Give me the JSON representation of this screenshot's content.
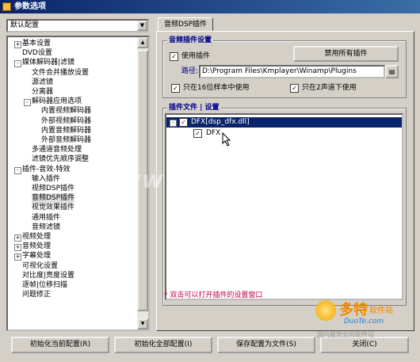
{
  "window": {
    "title": "参数选项"
  },
  "profile_combo": {
    "value": "默认配置"
  },
  "tree": [
    {
      "label": "基本设置",
      "level": 0,
      "exp": "+"
    },
    {
      "label": "DVD设置",
      "level": 0,
      "exp": ""
    },
    {
      "label": "媒体解码器|滤镜",
      "level": 0,
      "exp": "-"
    },
    {
      "label": "文件合并播放设置",
      "level": 1,
      "exp": ""
    },
    {
      "label": "源滤镜",
      "level": 1,
      "exp": ""
    },
    {
      "label": "分离器",
      "level": 1,
      "exp": ""
    },
    {
      "label": "解码器应用选项",
      "level": 1,
      "exp": "-"
    },
    {
      "label": "内置视频解码器",
      "level": 2,
      "exp": ""
    },
    {
      "label": "外部视频解码器",
      "level": 2,
      "exp": ""
    },
    {
      "label": "内置音频解码器",
      "level": 2,
      "exp": ""
    },
    {
      "label": "外部音频解码器",
      "level": 2,
      "exp": ""
    },
    {
      "label": "多通道音频处理",
      "level": 1,
      "exp": ""
    },
    {
      "label": "滤镜优先顺序调整",
      "level": 1,
      "exp": ""
    },
    {
      "label": "插件-音效-特效",
      "level": 0,
      "exp": "-"
    },
    {
      "label": "输入插件",
      "level": 1,
      "exp": ""
    },
    {
      "label": "视频DSP插件",
      "level": 1,
      "exp": ""
    },
    {
      "label": "音频DSP插件",
      "level": 1,
      "exp": "",
      "selected": true
    },
    {
      "label": "视觉效果插件",
      "level": 1,
      "exp": ""
    },
    {
      "label": "通用插件",
      "level": 1,
      "exp": ""
    },
    {
      "label": "音频滤镜",
      "level": 1,
      "exp": ""
    },
    {
      "label": "视频处理",
      "level": 0,
      "exp": "+"
    },
    {
      "label": "音频处理",
      "level": 0,
      "exp": "+"
    },
    {
      "label": "字幕处理",
      "level": 0,
      "exp": "+"
    },
    {
      "label": "可视化设置",
      "level": 0,
      "exp": ""
    },
    {
      "label": "对比度|亮度设置",
      "level": 0,
      "exp": ""
    },
    {
      "label": "逐帧|位移扫描",
      "level": 0,
      "exp": ""
    },
    {
      "label": "问题修正",
      "level": 0,
      "exp": ""
    }
  ],
  "tab": {
    "label": "音频DSP插件"
  },
  "settings_group": {
    "title": "音频插件设置",
    "use_plugin": "使用插件",
    "disable_all": "禁用所有插件",
    "path_label": "路径:",
    "path_value": "D:\\Program Files\\Kmplayer\\Winamp\\Plugins",
    "only_16bit": "只在16位样本中使用",
    "only_2ch": "只在2声道下使用"
  },
  "files_group": {
    "title": "插件文件 | 设置",
    "items": [
      {
        "label": "DFX[dsp_dfx.dll]",
        "selected": true
      },
      {
        "label": "DFX",
        "selected": false
      }
    ],
    "hint": "* 双击可以打开插件的设置窗口"
  },
  "bottom_buttons": {
    "init_current": "初始化当前配置(R)",
    "init_all": "初始化全部配置(I)",
    "save_to_file": "保存配置为文件(S)",
    "close": "关闭(C)"
  },
  "watermark": {
    "text": "www.DuoTe.com",
    "logo_main": "多特",
    "logo_sub": "软件站",
    "logo_url": "DuoTe.com",
    "logo_slogan": "国内最安全的软件站"
  },
  "colors": {
    "title_bar": "#0a246a",
    "group_title": "#00008b",
    "hint": "#c00040",
    "selection": "#0a246a"
  }
}
